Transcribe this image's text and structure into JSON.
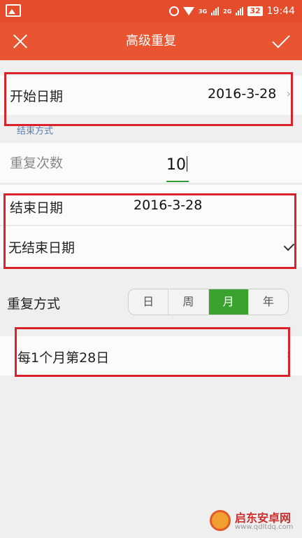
{
  "status_bar": {
    "network_labels": [
      "3G",
      "2G"
    ],
    "battery": "32",
    "time": "19:44"
  },
  "app_bar": {
    "title": "高级重复"
  },
  "start_date": {
    "label": "开始日期",
    "value": "2016-3-28"
  },
  "end_section": {
    "heading": "结束方式",
    "repeat_count_label": "重复次数",
    "repeat_count_value": "10",
    "end_date_label": "结束日期",
    "end_date_value": "2016-3-28",
    "no_end_label": "无结束日期",
    "selected_option": "无结束日期"
  },
  "repeat_mode": {
    "label": "重复方式",
    "options": [
      "日",
      "周",
      "月",
      "年"
    ],
    "selected": "月"
  },
  "summary": {
    "text": "每1个月第28日"
  },
  "watermark": {
    "name": "启东安卓网",
    "url": "www.qdltdq.com"
  },
  "colors": {
    "header": "#e85530",
    "highlight": "#d9222a",
    "active_segment": "#3aa32f"
  }
}
